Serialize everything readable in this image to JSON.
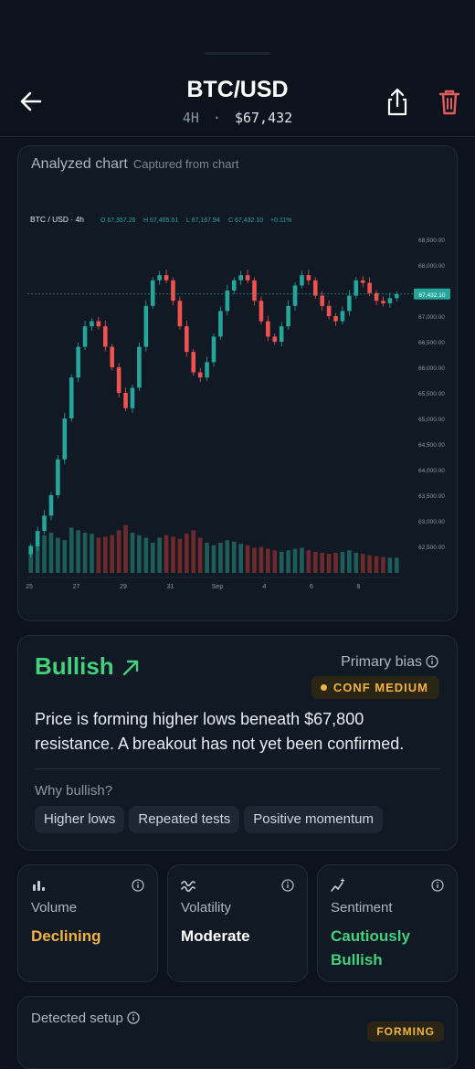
{
  "header": {
    "title": "BTC/USD",
    "timeframe": "4H",
    "separator": "·",
    "price": "$67,432"
  },
  "chart_card": {
    "title": "Analyzed chart",
    "subtitle": "Captured from chart",
    "legend": {
      "symbol": "BTC / USD · 4h",
      "open": "O 67,357.26",
      "high": "H 67,465.61",
      "low": "L 67,167.94",
      "close": "C 67,432.10",
      "change": "+0.11%"
    },
    "price_tag": "67,432.10"
  },
  "chart_data": {
    "type": "candlestick",
    "title": "BTC / USD · 4h",
    "y_ticks": [
      "68,500.00",
      "68,000.00",
      "67,500.00",
      "67,000.00",
      "66,500.00",
      "66,000.00",
      "65,500.00",
      "65,000.00",
      "64,500.00",
      "64,000.00",
      "63,500.00",
      "63,000.00",
      "62,500.00"
    ],
    "ylim": [
      62300,
      68600
    ],
    "x_ticks": [
      "25",
      "27",
      "29",
      "31",
      "Sep",
      "4",
      "6",
      "8"
    ],
    "last_price": 67432.1,
    "colors": {
      "up": "#26a69a",
      "down": "#ef5350",
      "up_volume": "#1f5d5a",
      "down_volume": "#6e2b2e"
    },
    "close_path": [
      62500,
      62800,
      63100,
      63500,
      64200,
      65000,
      65800,
      66400,
      66800,
      66900,
      66800,
      66400,
      66000,
      65500,
      65200,
      65600,
      66400,
      67200,
      67700,
      67800,
      67700,
      67300,
      66800,
      66300,
      65900,
      65800,
      66100,
      66600,
      67100,
      67500,
      67700,
      67800,
      67700,
      67300,
      66900,
      66600,
      66500,
      66800,
      67200,
      67600,
      67800,
      67700,
      67400,
      67200,
      67000,
      66900,
      67100,
      67400,
      67700,
      67650,
      67450,
      67300,
      67250,
      67350,
      67430
    ],
    "volume_series": [
      0.55,
      0.6,
      0.75,
      0.8,
      0.7,
      0.65,
      0.9,
      0.85,
      0.8,
      0.78,
      0.7,
      0.72,
      0.75,
      0.85,
      0.95,
      0.8,
      0.75,
      0.7,
      0.6,
      0.7,
      0.75,
      0.72,
      0.68,
      0.78,
      0.85,
      0.7,
      0.6,
      0.55,
      0.6,
      0.65,
      0.62,
      0.58,
      0.55,
      0.5,
      0.52,
      0.48,
      0.45,
      0.42,
      0.45,
      0.48,
      0.5,
      0.45,
      0.42,
      0.4,
      0.38,
      0.4,
      0.42,
      0.45,
      0.4,
      0.38,
      0.35,
      0.33,
      0.32,
      0.3,
      0.3
    ]
  },
  "bias": {
    "title": "Bullish",
    "primary_label": "Primary bias",
    "confidence": "CONF MEDIUM",
    "description": "Price is forming higher lows beneath $67,800 resistance. A breakout has not yet been confirmed.",
    "why_label": "Why bullish?",
    "reasons": [
      "Higher lows",
      "Repeated tests",
      "Positive momentum"
    ]
  },
  "metrics": [
    {
      "label": "Volume",
      "value": "Declining",
      "color": "#f2b441",
      "icon": "bar-chart-icon"
    },
    {
      "label": "Volatility",
      "value": "Moderate",
      "color": "#ffffff",
      "icon": "wave-icon"
    },
    {
      "label": "Sentiment",
      "value": "Cautiously Bullish",
      "color": "#43d17e",
      "icon": "trend-sparkle-icon"
    }
  ],
  "setup": {
    "label": "Detected setup",
    "badge": "FORMING"
  }
}
